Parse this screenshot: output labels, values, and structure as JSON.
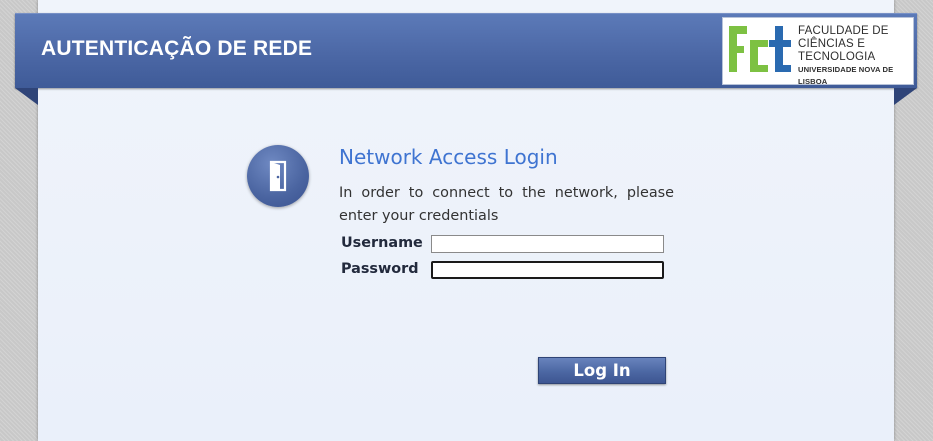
{
  "header": {
    "title": "AUTENTICAÇÃO DE REDE"
  },
  "logo": {
    "mark_text": "FCT",
    "line1": "FACULDADE DE",
    "line2": "CIÊNCIAS E TECNOLOGIA",
    "line3": "UNIVERSIDADE NOVA DE LISBOA",
    "colors": {
      "green": "#7dc142",
      "blue": "#2a6ab0"
    }
  },
  "login": {
    "icon": "door-icon",
    "title": "Network Access Login",
    "description": "In order to connect to the network, please enter your credentials",
    "username_label": "Username",
    "password_label": "Password",
    "username_value": "",
    "password_value": "",
    "button_label": "Log In"
  },
  "colors": {
    "header_blue": "#4f6aa8",
    "title_blue": "#3f74d1",
    "panel_bg": "#eef2fa"
  }
}
